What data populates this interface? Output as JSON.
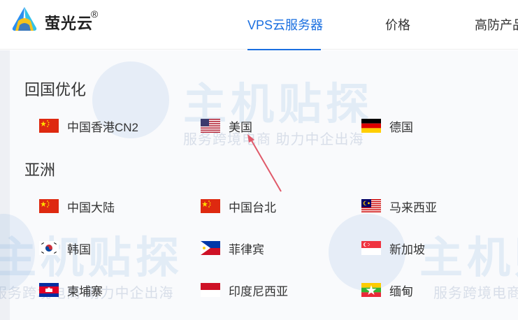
{
  "header": {
    "brand": "萤光云",
    "brand_mark": "®",
    "nav": [
      {
        "label": "VPS云服务器",
        "active": true
      },
      {
        "label": "价格",
        "active": false
      },
      {
        "label": "高防产品",
        "active": false
      }
    ]
  },
  "sections": [
    {
      "title": "回国优化",
      "regions": [
        {
          "label": "中国香港CN2",
          "flag": "china-flag"
        },
        {
          "label": "美国",
          "flag": "usa-flag"
        },
        {
          "label": "德国",
          "flag": "germany-flag"
        }
      ]
    },
    {
      "title": "亚洲",
      "regions": [
        {
          "label": "中国大陆",
          "flag": "china-flag"
        },
        {
          "label": "中国台北",
          "flag": "china-flag"
        },
        {
          "label": "马来西亚",
          "flag": "malaysia-flag"
        },
        {
          "label": "韩国",
          "flag": "korea-flag"
        },
        {
          "label": "菲律宾",
          "flag": "philippines-flag"
        },
        {
          "label": "新加坡",
          "flag": "singapore-flag"
        },
        {
          "label": "柬埔寨",
          "flag": "cambodia-flag"
        },
        {
          "label": "印度尼西亚",
          "flag": "indonesia-flag"
        },
        {
          "label": "缅甸",
          "flag": "myanmar-flag"
        }
      ]
    }
  ],
  "watermark": {
    "title": "主机贴探",
    "tagline": "服务跨境电商 助力中企出海"
  },
  "colors": {
    "accent": "#1a6fe0",
    "arrow": "#e05a6a"
  }
}
